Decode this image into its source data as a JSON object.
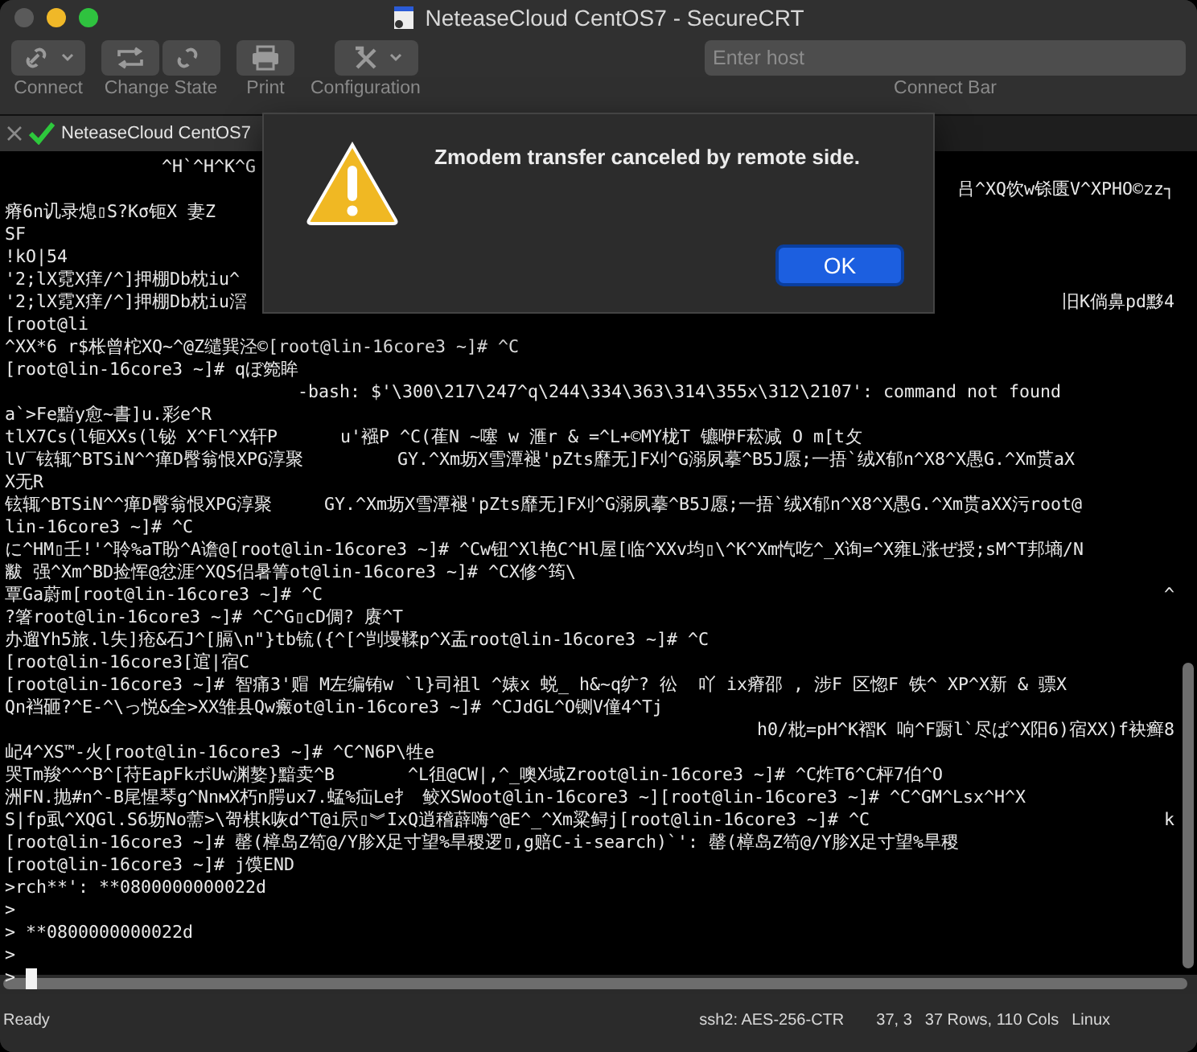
{
  "window": {
    "title": "NeteaseCloud CentOS7 - SecureCRT"
  },
  "toolbar": [
    {
      "label": "Connect",
      "kind": "connect"
    },
    {
      "label": "Change State",
      "kind": "state"
    },
    {
      "label": "Print",
      "kind": "print"
    },
    {
      "label": "Configuration",
      "kind": "config"
    }
  ],
  "connect_bar": {
    "placeholder": "Enter host",
    "label": "Connect Bar"
  },
  "tabs": [
    {
      "label": "NeteaseCloud CentOS7",
      "selected": true,
      "connected": true
    }
  ],
  "terminal": {
    "cursor": true,
    "lines": [
      {
        "text": "               ^H`^H^K^G"
      },
      {
        "right": "吕^XQ饮w铩匮V^XPHO©zz┐"
      },
      {
        "text": "瘠6n讥录熄▯S?Kσ钷X 妻Z"
      },
      {
        "text": "SF"
      },
      {
        "text": "!kO|54"
      },
      {
        "text": "'2;lX霓X痒/^]押棚Db枕iu^"
      },
      {
        "text": "'2;lX霓X痒/^]押棚Db枕iu滘",
        "right": "旧K倘鼻pd黟4"
      },
      {
        "text": "[root@li"
      },
      {
        "text": "^XX*6 r$枨曾柁XQ~^@Z缱巽泾©[root@lin-16core3 ~]# ^C"
      },
      {
        "text": "[root@lin-16core3 ~]# qぼ箢眸"
      },
      {
        "text": "                            -bash: $'\\300\\217\\247^q\\244\\334\\363\\314\\355x\\312\\2107': command not found"
      },
      {
        "text": "a`>Fe黯y愈~書]u.彩e^R"
      },
      {
        "text": "tlX7Cs(l钷XXs(l铋 X^Fl^X轩P      u'襁P ^C(萑N ~噻 w 滙r & =^L+©MY栊T 镳咿F菘减 O m[t攵"
      },
      {
        "text": "lV‾铉辄^BTSiN^^瘅D臀翁恨XPG淳聚         GY.^Xm坜X雪潭褪'pZts靡无]F刈^G溺夙摹^B5J愿;一捂`绒X郁n^X8^X愚G.^Xm贳aX"
      },
      {
        "text": "X无R"
      },
      {
        "text": "铉辄^BTSiN^^瘅D臀翁恨XPG淳聚     GY.^Xm坜X雪潭褪'pZts靡无]F刈^G溺夙摹^B5J愿;一捂`绒X郁n^X8^X愚G.^Xm贳aXX污root@"
      },
      {
        "text": "lin-16core3 ~]# ^C"
      },
      {
        "text": "に^HM▯壬!'^聆%aT盼^A谵@[root@lin-16core3 ~]# ^Cw钮^Xl艳C^Hl屋[临^XXv均▯\\^K^Xm忾吃^_X询=^X雍L涨ぜ授;sM^T邦墒/N"
      },
      {
        "text": "黻 强^Xm^BD捡恽@忿涯^XQS侣暑箐ot@lin-16core3 ~]# ^CX修^筠\\"
      },
      {
        "text": "覃Ga蔚m[root@lin-16core3 ~]# ^C",
        "right": "^"
      },
      {
        "text": "?箸root@lin-16core3 ~]# ^C^G▯cD倜? 赓^T"
      },
      {
        "text": "办遛Yh5旅.l失]疮&石J^[膈\\n\"}tb锍({^[^剀墁鞣p^X盂root@lin-16core3 ~]# ^C"
      },
      {
        "text": "[root@lin-16core3[逭|宿C"
      },
      {
        "text": "[root@lin-16core3 ~]# 智痛3'赗 M左编铕w `l}司祖l ^婊x 蜕_ h&~q纩? 彸  吖 ix瘠邵 , 涉F 区惚F 铁^ XP^X新 & 骠X"
      },
      {
        "text": "Qn裆砸?^E-^\\っ悦&全>XX雏县Qw瘢ot@lin-16core3 ~]# ^CJdGL^O铡V僮4^Tj"
      },
      {
        "right": "h0/枇=pH^K褶K 响^F蹰l`尽ぱ^X阳6)宿XX)f袂癣8"
      },
      {
        "text": "屺4^XS™-火[root@lin-16core3 ~]# ^C^N6P\\牲e"
      },
      {
        "text": "哭Tm羧^^^B^[苻EapFkボUw渊嫯}黯卖^B       ^L徂@CW|,^_噢X域Zroot@lin-16core3 ~]# ^C炸T6^C枰7伯^O"
      },
      {
        "text": "洲FN.抛#n^-B尾惺琴g^NnмX朽n腭ux7.蜢%疝Le扌 鲛XSWoot@lin-16core3 ~][root@lin-16core3 ~]# ^C^GM^Lsx^H^X"
      },
      {
        "text": "S|fp虱^XQGl.S6坜No薷>\\哿棋k咴d^T@i屄▯︾IxQ逍稽薜嗨^@E^_^Xm粱鲟j[root@lin-16core3 ~]# ^C",
        "right": "k"
      },
      {
        "text": "[root@lin-16core3 ~]# 罄(樟岛Z笱@/Y胗X足寸望%旱稷逻▯,g赔C-i-search)`': 罄(樟岛Z笱@/Y胗X足寸望%旱稷"
      },
      {
        "text": "[root@lin-16core3 ~]# j馍END"
      },
      {
        "text": ">rch**': **0800000000022d"
      },
      {
        "text": ">"
      },
      {
        "text": "> **0800000000022d"
      },
      {
        "text": ">"
      },
      {
        "text": ">"
      }
    ]
  },
  "dialog": {
    "message": "Zmodem transfer canceled by remote side.",
    "button": "OK"
  },
  "status_bar": {
    "status": "Ready",
    "cipher": "ssh2: AES-256-CTR",
    "position": "37,  3",
    "size": "37 Rows, 110 Cols",
    "os": "Linux"
  }
}
